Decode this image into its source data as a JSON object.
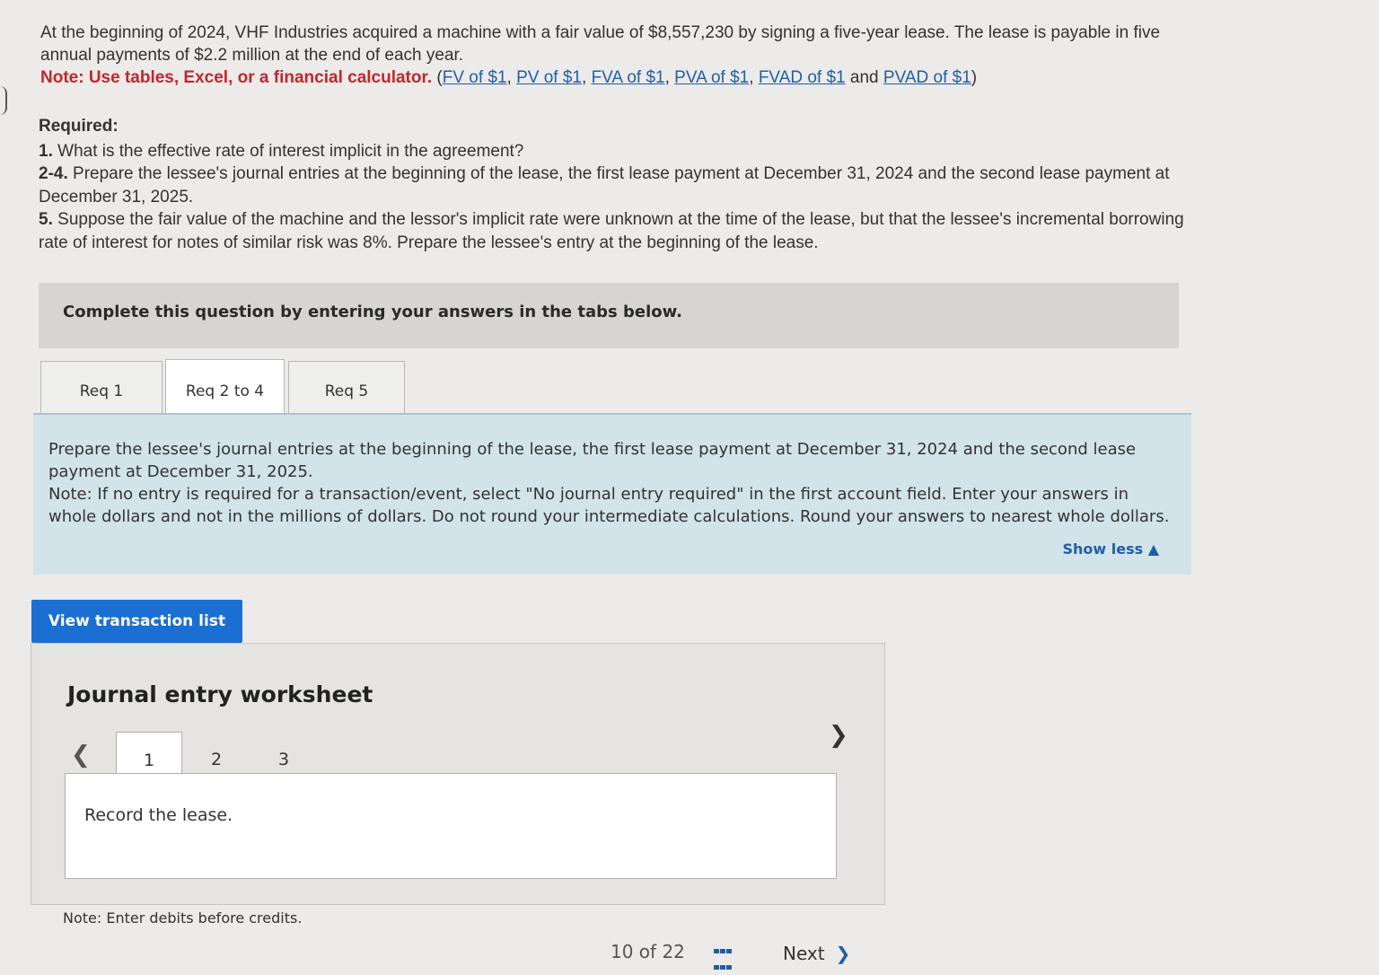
{
  "problem": {
    "line1": "At the beginning of 2024, VHF Industries acquired a machine with a fair value of $8,557,230 by signing a five-year lease. The lease is payable in five annual payments of $2.2 million at the end of each year.",
    "note_label": "Note: Use tables, Excel, or a financial calculator.",
    "links": [
      "FV of $1",
      "PV of $1",
      "FVA of $1",
      "PVA of $1",
      "FVAD of $1",
      "PVAD of $1"
    ],
    "and_word": "and"
  },
  "required": {
    "heading": "Required:",
    "items": [
      {
        "num": "1.",
        "text": "What is the effective rate of interest implicit in the agreement?"
      },
      {
        "num": "2-4.",
        "text": "Prepare the lessee's journal entries at the beginning of the lease, the first lease payment at December 31, 2024 and the second lease payment at December 31, 2025."
      },
      {
        "num": "5.",
        "text": "Suppose the fair value of the machine and the lessor's implicit rate were unknown at the time of the lease, but that the lessee's incremental borrowing rate of interest for notes of similar risk was 8%. Prepare the lessee's entry at the beginning of the lease."
      }
    ]
  },
  "complete_box": "Complete this question by entering your answers in the tabs below.",
  "tabs": [
    {
      "label": "Req 1",
      "active": false
    },
    {
      "label": "Req 2 to 4",
      "active": true
    },
    {
      "label": "Req 5",
      "active": false
    }
  ],
  "instructions": {
    "main": "Prepare the lessee's journal entries at the beginning of the lease, the first lease payment at December 31, 2024 and the second lease payment at December 31, 2025.",
    "note": "Note: If no entry is required for a transaction/event, select \"No journal entry required\" in the first account field. Enter your answers in whole dollars and not in the millions of dollars. Do not round your intermediate calculations. Round your answers to nearest whole dollars.",
    "show_less": "Show less ▲"
  },
  "view_transaction_list": "View transaction list",
  "worksheet": {
    "title": "Journal entry worksheet",
    "pages": [
      "1",
      "2",
      "3"
    ],
    "active_page": "1",
    "prompt": "Record the lease.",
    "prev_icon": "chevron-left-icon",
    "next_icon": "chevron-right-icon"
  },
  "debit_note": "Note: Enter debits before credits.",
  "bottom": {
    "page_indicator": "10 of 22",
    "next_label": "Next"
  },
  "colors": {
    "link": "#1f5fa8",
    "note_red": "#c0272d",
    "button_blue": "#1b6fd3",
    "instruction_bg": "#d2e3ea"
  }
}
